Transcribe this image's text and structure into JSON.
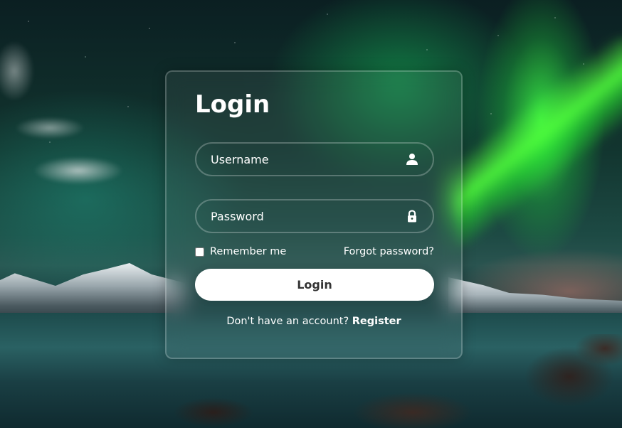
{
  "form": {
    "title": "Login",
    "username": {
      "placeholder": "Username",
      "icon": "user-icon"
    },
    "password": {
      "placeholder": "Password",
      "icon": "lock-icon"
    },
    "remember_label": "Remember me",
    "forgot_label": "Forgot password?",
    "login_button": "Login",
    "register_prompt": "Don't have an account?",
    "register_link": "Register"
  },
  "colors": {
    "button_bg": "#ffffff",
    "button_text": "#333333",
    "text": "#ffffff"
  }
}
